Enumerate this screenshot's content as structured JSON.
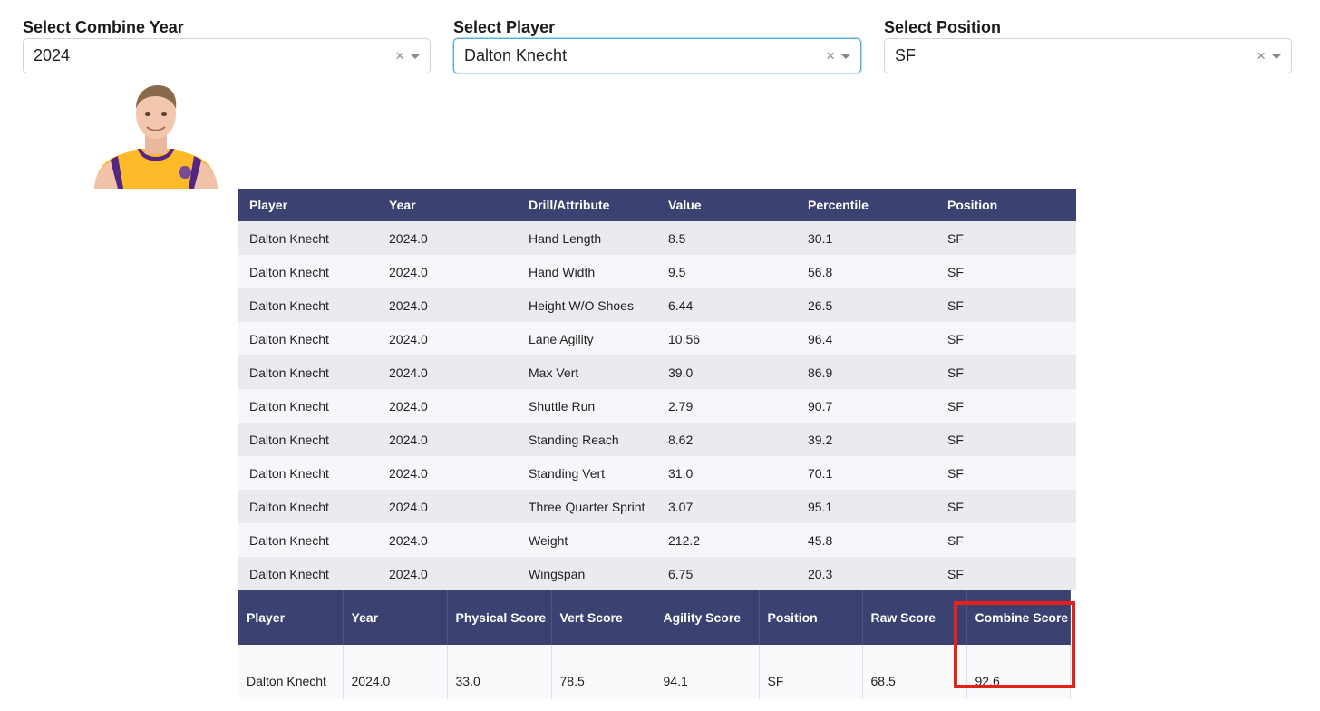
{
  "filters": {
    "year": {
      "label": "Select Combine Year",
      "value": "2024",
      "clear": "×"
    },
    "player": {
      "label": "Select Player",
      "value": "Dalton Knecht",
      "clear": "×"
    },
    "position": {
      "label": "Select Position",
      "value": "SF",
      "clear": "×"
    }
  },
  "drills_table": {
    "headers": [
      "Player",
      "Year",
      "Drill/Attribute",
      "Value",
      "Percentile",
      "Position"
    ],
    "rows": [
      [
        "Dalton Knecht",
        "2024.0",
        "Hand Length",
        "8.5",
        "30.1",
        "SF"
      ],
      [
        "Dalton Knecht",
        "2024.0",
        "Hand Width",
        "9.5",
        "56.8",
        "SF"
      ],
      [
        "Dalton Knecht",
        "2024.0",
        "Height W/O Shoes",
        "6.44",
        "26.5",
        "SF"
      ],
      [
        "Dalton Knecht",
        "2024.0",
        "Lane Agility",
        "10.56",
        "96.4",
        "SF"
      ],
      [
        "Dalton Knecht",
        "2024.0",
        "Max Vert",
        "39.0",
        "86.9",
        "SF"
      ],
      [
        "Dalton Knecht",
        "2024.0",
        "Shuttle Run",
        "2.79",
        "90.7",
        "SF"
      ],
      [
        "Dalton Knecht",
        "2024.0",
        "Standing Reach",
        "8.62",
        "39.2",
        "SF"
      ],
      [
        "Dalton Knecht",
        "2024.0",
        "Standing Vert",
        "31.0",
        "70.1",
        "SF"
      ],
      [
        "Dalton Knecht",
        "2024.0",
        "Three Quarter Sprint",
        "3.07",
        "95.1",
        "SF"
      ],
      [
        "Dalton Knecht",
        "2024.0",
        "Weight",
        "212.2",
        "45.8",
        "SF"
      ],
      [
        "Dalton Knecht",
        "2024.0",
        "Wingspan",
        "6.75",
        "20.3",
        "SF"
      ]
    ]
  },
  "scores_table": {
    "headers": [
      "Player",
      "Year",
      "Physical Score",
      "Vert Score",
      "Agility Score",
      "Position",
      "Raw Score",
      "Combine Score"
    ],
    "row": [
      "Dalton Knecht",
      "2024.0",
      "33.0",
      "78.5",
      "94.1",
      "SF",
      "68.5",
      "92.6"
    ]
  },
  "colors": {
    "header_bg": "#3b4170",
    "highlight": "#e8201a",
    "jersey": "#fdb927"
  }
}
